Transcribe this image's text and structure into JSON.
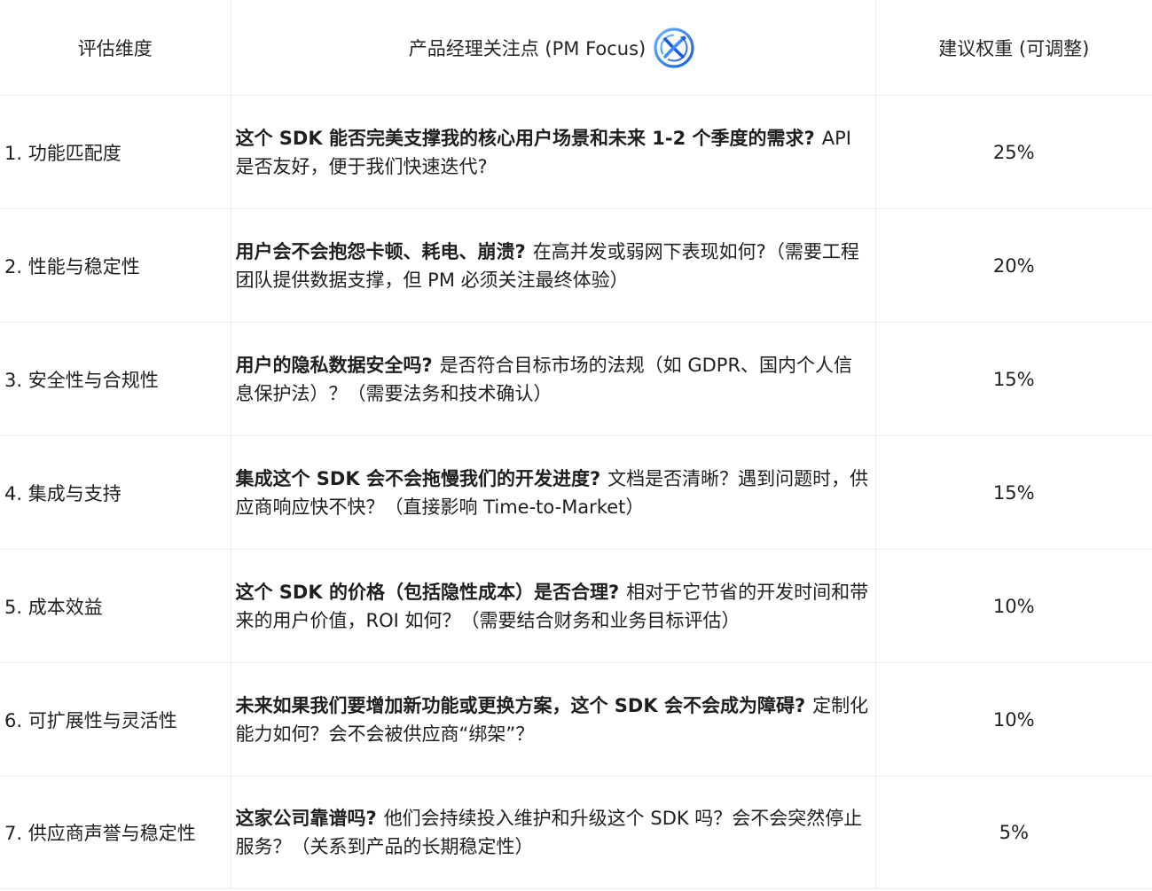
{
  "table": {
    "headers": {
      "dimension": "评估维度",
      "focus": "产品经理关注点 (PM Focus)",
      "weight": "建议权重 (可调整)"
    },
    "logo_icon": "x-swirl-logo-icon",
    "accent_color": "#1a73e8",
    "rows": [
      {
        "dimension": "1. 功能匹配度",
        "focus_bold": "这个 SDK 能否完美支撑我的核心用户场景和未来 1-2 个季度的需求?",
        "focus_text": "API 是否友好，便于我们快速迭代?",
        "weight": "25%"
      },
      {
        "dimension": "2. 性能与稳定性",
        "focus_bold": "用户会不会抱怨卡顿、耗电、崩溃?",
        "focus_text": "在高并发或弱网下表现如何?（需要工程团队提供数据支撑，但 PM 必须关注最终体验）",
        "weight": "20%"
      },
      {
        "dimension": "3. 安全性与合规性",
        "focus_bold": "用户的隐私数据安全吗?",
        "focus_text": "是否符合目标市场的法规（如 GDPR、国内个人信息保护法）？（需要法务和技术确认）",
        "weight": "15%"
      },
      {
        "dimension": "4. 集成与支持",
        "focus_bold": "集成这个 SDK 会不会拖慢我们的开发进度?",
        "focus_text": "文档是否清晰？遇到问题时，供应商响应快不快？（直接影响 Time-to-Market）",
        "weight": "15%"
      },
      {
        "dimension": "5. 成本效益",
        "focus_bold": "这个 SDK 的价格（包括隐性成本）是否合理?",
        "focus_text": "相对于它节省的开发时间和带来的用户价值，ROI 如何？（需要结合财务和业务目标评估）",
        "weight": "10%"
      },
      {
        "dimension": "6. 可扩展性与灵活性",
        "focus_bold": "未来如果我们要增加新功能或更换方案，这个 SDK 会不会成为障碍?",
        "focus_text": "定制化能力如何？会不会被供应商“绑架”？",
        "weight": "10%"
      },
      {
        "dimension": "7. 供应商声誉与稳定性",
        "focus_bold": "这家公司靠谱吗?",
        "focus_text": "他们会持续投入维护和升级这个 SDK 吗？会不会突然停止服务？（关系到产品的长期稳定性）",
        "weight": "5%"
      }
    ]
  }
}
